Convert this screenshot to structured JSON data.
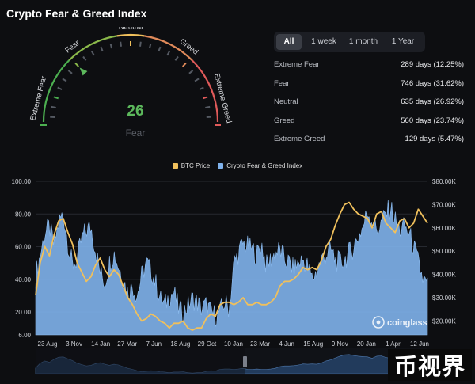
{
  "page": {
    "title": "Crypto Fear & Greed Index"
  },
  "gauge": {
    "value": "26",
    "status": "Fear",
    "value_number": 26,
    "labels": [
      "Extreme Fear",
      "Fear",
      "Neutral",
      "Greed",
      "Extreme Greed"
    ]
  },
  "tabs": [
    {
      "label": "All",
      "active": true
    },
    {
      "label": "1 week",
      "active": false
    },
    {
      "label": "1 month",
      "active": false
    },
    {
      "label": "1 Year",
      "active": false
    }
  ],
  "stats": [
    {
      "label": "Extreme Fear",
      "value": "289 days (12.25%)"
    },
    {
      "label": "Fear",
      "value": "746 days (31.62%)"
    },
    {
      "label": "Neutral",
      "value": "635 days (26.92%)"
    },
    {
      "label": "Greed",
      "value": "560 days (23.74%)"
    },
    {
      "label": "Extreme Greed",
      "value": "129 days (5.47%)"
    }
  ],
  "watermark": {
    "brand": "coinglass",
    "corner": "币视界"
  },
  "colors": {
    "btc": "#f0c05c",
    "index": "#7fb2ec",
    "accent_green": "#5cb85c",
    "extreme_fear": "#4caf50",
    "extreme_greed": "#e05a5a"
  },
  "chart_data": {
    "type": "area",
    "legend": [
      "BTC Price",
      "Crypto Fear & Greed Index"
    ],
    "legend_position": "top-center",
    "x_ticks": [
      "23 Aug",
      "3 Nov",
      "14 Jan",
      "27 Mar",
      "7 Jun",
      "18 Aug",
      "29 Oct",
      "10 Jan",
      "23 Mar",
      "4 Jun",
      "15 Aug",
      "9 Nov",
      "20 Jan",
      "1 Apr",
      "12 Jun"
    ],
    "y_left_ticks": [
      "100.00",
      "80.00",
      "60.00",
      "40.00",
      "20.00",
      "6.00"
    ],
    "y_left_range": [
      6,
      100
    ],
    "y_right_ticks": [
      "$80.00K",
      "$70.00K",
      "$60.00K",
      "$50.00K",
      "$40.00K",
      "$30.00K",
      "$20.00K"
    ],
    "y_right_range": [
      14000,
      80000
    ],
    "grid": true,
    "series": [
      {
        "name": "Crypto Fear & Greed Index",
        "axis": "left",
        "values": [
          42,
          55,
          68,
          72,
          60,
          75,
          80,
          62,
          48,
          52,
          65,
          70,
          72,
          58,
          44,
          38,
          50,
          56,
          48,
          40,
          32,
          36,
          30,
          42,
          50,
          46,
          38,
          28,
          24,
          30,
          32,
          22,
          20,
          24,
          28,
          26,
          22,
          24,
          20,
          18,
          20,
          26,
          22,
          50,
          56,
          62,
          60,
          58,
          55,
          62,
          48,
          52,
          56,
          58,
          52,
          50,
          46,
          50,
          52,
          48,
          40,
          45,
          52,
          55,
          58,
          52,
          50,
          52,
          56,
          60,
          66,
          72,
          82,
          76,
          70,
          74,
          80,
          84,
          76,
          70,
          72,
          68,
          60,
          50,
          40,
          36
        ]
      },
      {
        "name": "BTC Price",
        "axis": "right",
        "values": [
          31,
          45,
          52,
          48,
          57,
          63,
          64,
          58,
          53,
          45,
          41,
          37,
          39,
          44,
          47,
          42,
          39,
          42,
          40,
          35,
          30,
          27,
          23,
          20,
          21,
          23,
          22,
          20,
          19,
          17,
          19,
          19,
          20,
          17,
          16,
          17,
          17,
          21,
          23,
          22,
          27,
          28,
          28,
          27,
          28,
          30,
          27,
          27,
          28,
          27,
          27,
          28,
          30,
          35,
          37,
          37,
          38,
          40,
          43,
          42,
          43,
          42,
          46,
          52,
          55,
          61,
          66,
          70,
          71,
          68,
          66,
          65,
          64,
          60,
          66,
          67,
          62,
          60,
          58,
          63,
          64,
          60,
          62,
          68,
          65,
          62
        ]
      }
    ]
  }
}
